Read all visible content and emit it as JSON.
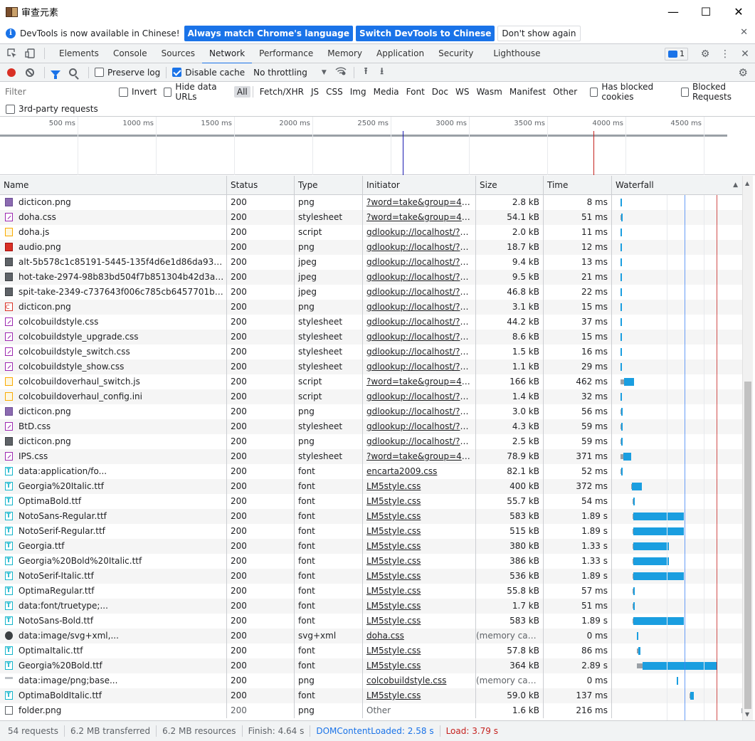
{
  "window": {
    "title": "审查元素",
    "minimize": "—",
    "maximize": "☐",
    "close": "✕"
  },
  "infobar": {
    "icon": "i",
    "message": "DevTools is now available in Chinese!",
    "btn_match": "Always match Chrome's language",
    "btn_switch": "Switch DevTools to Chinese",
    "btn_dismiss": "Don't show again",
    "close": "✕"
  },
  "tabs": [
    "Elements",
    "Console",
    "Sources",
    "Network",
    "Performance",
    "Memory",
    "Application",
    "Security",
    "Lighthouse"
  ],
  "active_tab": "Network",
  "issues_count": "1",
  "toolbar": {
    "preserve_log": "Preserve log",
    "disable_cache": "Disable cache",
    "throttling": "No throttling"
  },
  "filter": {
    "placeholder": "Filter",
    "invert": "Invert",
    "hide_data_urls": "Hide data URLs",
    "types": [
      "All",
      "Fetch/XHR",
      "JS",
      "CSS",
      "Img",
      "Media",
      "Font",
      "Doc",
      "WS",
      "Wasm",
      "Manifest",
      "Other"
    ],
    "has_blocked_cookies": "Has blocked cookies",
    "blocked_requests": "Blocked Requests",
    "third_party": "3rd-party requests"
  },
  "overview": {
    "ticks": [
      "500 ms",
      "1000 ms",
      "1500 ms",
      "2000 ms",
      "2500 ms",
      "3000 ms",
      "3500 ms",
      "4000 ms",
      "4500 ms"
    ]
  },
  "columns": [
    "Name",
    "Status",
    "Type",
    "Initiator",
    "Size",
    "Time",
    "Waterfall"
  ],
  "rows": [
    {
      "icon": "png",
      "name": "dicticon.png",
      "status": "200",
      "type": "png",
      "initiator": "?word=take&group=4294...",
      "size": "2.8 kB",
      "time": "8 ms",
      "wf": [
        0.01,
        0.003,
        0.005
      ]
    },
    {
      "icon": "css",
      "name": "doha.css",
      "status": "200",
      "type": "stylesheet",
      "initiator": "?word=take&group=4294...",
      "size": "54.1 kB",
      "time": "51 ms",
      "wf": [
        0.01,
        0.004,
        0.01
      ]
    },
    {
      "icon": "js",
      "name": "doha.js",
      "status": "200",
      "type": "script",
      "initiator": "gdlookup://localhost/?wor...",
      "size": "2.0 kB",
      "time": "11 ms",
      "wf": [
        0.01,
        0.003,
        0.005
      ]
    },
    {
      "icon": "audio",
      "name": "audio.png",
      "status": "200",
      "type": "png",
      "initiator": "gdlookup://localhost/?wor...",
      "size": "18.7 kB",
      "time": "12 ms",
      "wf": [
        0.01,
        0.003,
        0.005
      ]
    },
    {
      "icon": "jpeg",
      "name": "alt-5b578c1c85191-5445-135f4d6e1d86da93dc447d...",
      "status": "200",
      "type": "jpeg",
      "initiator": "gdlookup://localhost/?wor...",
      "size": "9.4 kB",
      "time": "13 ms",
      "wf": [
        0.01,
        0.003,
        0.005
      ]
    },
    {
      "icon": "jpeg",
      "name": "hot-take-2974-98b83bd504f7b851304b42d3a52a83...",
      "status": "200",
      "type": "jpeg",
      "initiator": "gdlookup://localhost/?wor...",
      "size": "9.5 kB",
      "time": "21 ms",
      "wf": [
        0.01,
        0.003,
        0.006
      ]
    },
    {
      "icon": "jpeg",
      "name": "spit-take-2349-c737643f006c785cb6457701b016c2f...",
      "status": "200",
      "type": "jpeg",
      "initiator": "gdlookup://localhost/?wor...",
      "size": "46.8 kB",
      "time": "22 ms",
      "wf": [
        0.01,
        0.003,
        0.006
      ]
    },
    {
      "icon": "ico",
      "name": "dicticon.png",
      "status": "200",
      "type": "png",
      "initiator": "gdlookup://localhost/?wor...",
      "size": "3.1 kB",
      "time": "15 ms",
      "wf": [
        0.01,
        0.003,
        0.005
      ]
    },
    {
      "icon": "css",
      "name": "colcobuildstyle.css",
      "status": "200",
      "type": "stylesheet",
      "initiator": "gdlookup://localhost/?wor...",
      "size": "44.2 kB",
      "time": "37 ms",
      "wf": [
        0.01,
        0.003,
        0.008
      ]
    },
    {
      "icon": "css",
      "name": "colcobuildstyle_upgrade.css",
      "status": "200",
      "type": "stylesheet",
      "initiator": "gdlookup://localhost/?wor...",
      "size": "8.6 kB",
      "time": "15 ms",
      "wf": [
        0.01,
        0.003,
        0.005
      ]
    },
    {
      "icon": "css",
      "name": "colcobuildstyle_switch.css",
      "status": "200",
      "type": "stylesheet",
      "initiator": "gdlookup://localhost/?wor...",
      "size": "1.5 kB",
      "time": "16 ms",
      "wf": [
        0.01,
        0.003,
        0.005
      ]
    },
    {
      "icon": "css",
      "name": "colcobuildstyle_show.css",
      "status": "200",
      "type": "stylesheet",
      "initiator": "gdlookup://localhost/?wor...",
      "size": "1.1 kB",
      "time": "29 ms",
      "wf": [
        0.01,
        0.003,
        0.007
      ]
    },
    {
      "icon": "js",
      "name": "colcobuildoverhaul_switch.js",
      "status": "200",
      "type": "script",
      "initiator": "?word=take&group=4294...",
      "size": "166 kB",
      "time": "462 ms",
      "wf": [
        0.01,
        0.03,
        0.075
      ]
    },
    {
      "icon": "js",
      "name": "colcobuildoverhaul_config.ini",
      "status": "200",
      "type": "script",
      "initiator": "gdlookup://localhost/?wor...",
      "size": "1.4 kB",
      "time": "32 ms",
      "wf": [
        0.01,
        0.003,
        0.008
      ]
    },
    {
      "icon": "png",
      "name": "dicticon.png",
      "status": "200",
      "type": "png",
      "initiator": "gdlookup://localhost/?wor...",
      "size": "3.0 kB",
      "time": "56 ms",
      "wf": [
        0.01,
        0.004,
        0.012
      ]
    },
    {
      "icon": "css",
      "name": "BtD.css",
      "status": "200",
      "type": "stylesheet",
      "initiator": "gdlookup://localhost/?wor...",
      "size": "4.3 kB",
      "time": "59 ms",
      "wf": [
        0.01,
        0.004,
        0.012
      ]
    },
    {
      "icon": "jpeg",
      "name": "dicticon.png",
      "status": "200",
      "type": "png",
      "initiator": "gdlookup://localhost/?wor...",
      "size": "2.5 kB",
      "time": "59 ms",
      "wf": [
        0.01,
        0.004,
        0.012
      ]
    },
    {
      "icon": "css",
      "name": "IPS.css",
      "status": "200",
      "type": "stylesheet",
      "initiator": "?word=take&group=4294...",
      "size": "78.9 kB",
      "time": "371 ms",
      "wf": [
        0.01,
        0.025,
        0.06
      ]
    },
    {
      "icon": "font",
      "name": "data:application/fo...",
      "status": "200",
      "type": "font",
      "initiator": "encarta2009.css",
      "size": "82.1 kB",
      "time": "52 ms",
      "wf": [
        0.012,
        0.004,
        0.01
      ]
    },
    {
      "icon": "font",
      "name": "Georgia%20Italic.ttf",
      "status": "200",
      "type": "font",
      "initiator": "LM5style.css",
      "size": "400 kB",
      "time": "372 ms",
      "wf": [
        0.095,
        0.004,
        0.075
      ]
    },
    {
      "icon": "font",
      "name": "OptimaBold.ttf",
      "status": "200",
      "type": "font",
      "initiator": "LM5style.css",
      "size": "55.7 kB",
      "time": "54 ms",
      "wf": [
        0.103,
        0.004,
        0.012
      ]
    },
    {
      "icon": "font",
      "name": "NotoSans-Regular.ttf",
      "status": "200",
      "type": "font",
      "initiator": "LM5style.css",
      "size": "583 kB",
      "time": "1.89 s",
      "wf": [
        0.103,
        0.005,
        0.39
      ]
    },
    {
      "icon": "font",
      "name": "NotoSerif-Regular.ttf",
      "status": "200",
      "type": "font",
      "initiator": "LM5style.css",
      "size": "515 kB",
      "time": "1.89 s",
      "wf": [
        0.103,
        0.005,
        0.39
      ]
    },
    {
      "icon": "font",
      "name": "Georgia.ttf",
      "status": "200",
      "type": "font",
      "initiator": "LM5style.css",
      "size": "380 kB",
      "time": "1.33 s",
      "wf": [
        0.103,
        0.005,
        0.275
      ]
    },
    {
      "icon": "font",
      "name": "Georgia%20Bold%20Italic.ttf",
      "status": "200",
      "type": "font",
      "initiator": "LM5style.css",
      "size": "386 kB",
      "time": "1.33 s",
      "wf": [
        0.103,
        0.005,
        0.275
      ]
    },
    {
      "icon": "font",
      "name": "NotoSerif-Italic.ttf",
      "status": "200",
      "type": "font",
      "initiator": "LM5style.css",
      "size": "536 kB",
      "time": "1.89 s",
      "wf": [
        0.103,
        0.005,
        0.39
      ]
    },
    {
      "icon": "font",
      "name": "OptimaRegular.ttf",
      "status": "200",
      "type": "font",
      "initiator": "LM5style.css",
      "size": "55.8 kB",
      "time": "57 ms",
      "wf": [
        0.103,
        0.004,
        0.012
      ]
    },
    {
      "icon": "font",
      "name": "data:font/truetype;...",
      "status": "200",
      "type": "font",
      "initiator": "LM5style.css",
      "size": "1.7 kB",
      "time": "51 ms",
      "wf": [
        0.103,
        0.004,
        0.01
      ]
    },
    {
      "icon": "font",
      "name": "NotoSans-Bold.ttf",
      "status": "200",
      "type": "font",
      "initiator": "LM5style.css",
      "size": "583 kB",
      "time": "1.89 s",
      "wf": [
        0.103,
        0.005,
        0.39
      ]
    },
    {
      "icon": "svg",
      "name": "data:image/svg+xml,...",
      "status": "200",
      "type": "svg+xml",
      "initiator": "doha.css",
      "size": "(memory cache)",
      "time": "0 ms",
      "muted": true,
      "wf": [
        0.138,
        0.0,
        0.006
      ]
    },
    {
      "icon": "font",
      "name": "OptimaItalic.ttf",
      "status": "200",
      "type": "font",
      "initiator": "LM5style.css",
      "size": "57.8 kB",
      "time": "86 ms",
      "wf": [
        0.138,
        0.01,
        0.014
      ]
    },
    {
      "icon": "font",
      "name": "Georgia%20Bold.ttf",
      "status": "200",
      "type": "font",
      "initiator": "LM5style.css",
      "size": "364 kB",
      "time": "2.89 s",
      "wf": [
        0.138,
        0.045,
        0.57
      ]
    },
    {
      "icon": "data-png",
      "name": "data:image/png;base...",
      "status": "200",
      "type": "png",
      "initiator": "colcobuildstyle.css",
      "size": "(memory cache)",
      "time": "0 ms",
      "muted": true,
      "wf": [
        0.445,
        0.0,
        0.006
      ]
    },
    {
      "icon": "font",
      "name": "OptimaBoldItalic.ttf",
      "status": "200",
      "type": "font",
      "initiator": "LM5style.css",
      "size": "59.0 kB",
      "time": "137 ms",
      "wf": [
        0.54,
        0.008,
        0.025
      ]
    },
    {
      "icon": "blank",
      "name": "folder.png",
      "status": "200",
      "type": "png",
      "initiator": "Other",
      "size": "1.6 kB",
      "time": "216 ms",
      "muted_status": true,
      "muted_initiator": true,
      "wf": [
        0.94,
        0.03,
        0.01
      ]
    }
  ],
  "status_bar": {
    "requests": "54 requests",
    "transferred": "6.2 MB transferred",
    "resources": "6.2 MB resources",
    "finish": "Finish: 4.64 s",
    "dcl": "DOMContentLoaded: 2.58 s",
    "load": "Load: 3.79 s"
  },
  "colors": {
    "accent": "#1a73e8",
    "bar": "#1a9ee0",
    "load": "#c5221f",
    "record": "#d93025"
  }
}
